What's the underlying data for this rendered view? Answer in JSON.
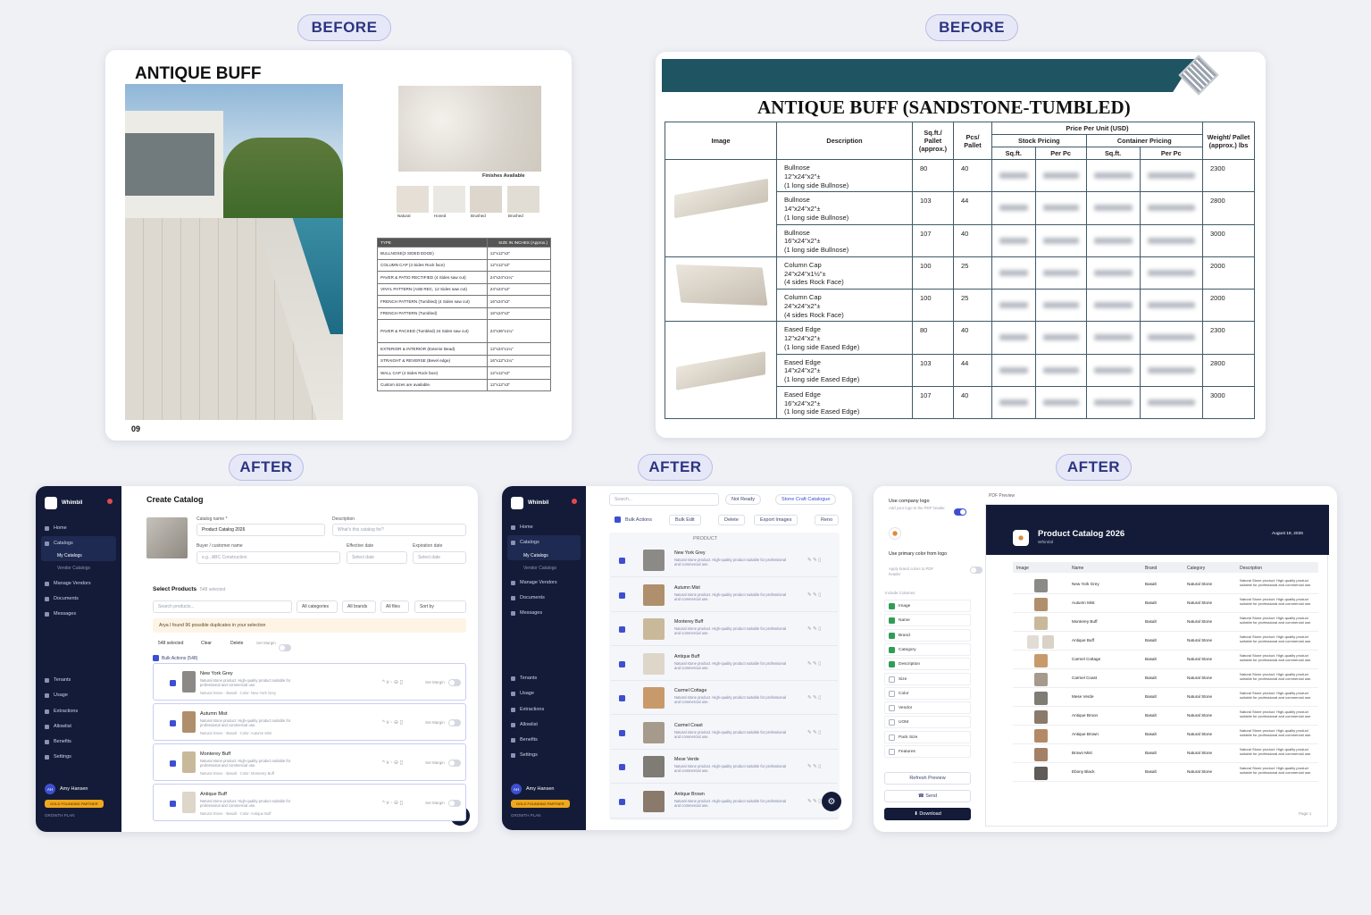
{
  "labels": {
    "before": "BEFORE",
    "after": "AFTER"
  },
  "before1": {
    "title": "ANTIQUE BUFF",
    "finishes_title": "Finishes Available",
    "finishes": [
      "Natural",
      "Honed",
      "Brushed",
      "Brushed"
    ],
    "table_header": [
      "TYPE",
      "SIZE IN INCHES (Approx.)"
    ],
    "rows": [
      [
        "BULLNOSE(3 SIDED EDGE)",
        "12\"x12\"x2\"",
        "12\"x12\"x2\""
      ],
      [
        "COLUMN CAP (4 Sides Rock face)",
        "12\"x12\"x2\""
      ],
      [
        "PAVER & PATIO RECTIFIED (4 Sides saw cut)",
        "24\"x24\"x1¼\""
      ],
      [
        "VINYL PATTERN (ASB REC, 12 Sides saw cut)",
        "24\"x24\"x2\""
      ],
      [
        "FRENCH PATTERN (Tumbled) (4 Sides saw cut)",
        "16\"x24\"x2\""
      ],
      [
        "FRENCH PATTERN (Tumbled)",
        "16\"x24\"x2\""
      ],
      [
        "PAVER & PACKED (Tumbled) 24 Sides saw cut)",
        "24\"x36\"x1¼\"",
        "12\"x12\"x1¼\""
      ],
      [
        "EXTERIOR & INTERIOR (Exterior Bead)",
        "12\"x24\"x1¼\""
      ],
      [
        "STRAIGHT & REVERSE (Bevel edge)",
        "16\"x12\"x1¼\""
      ],
      [
        "WALL CAP (4 Sides Rock face)",
        "12\"x12\"x2\""
      ],
      [
        "Custom sizes are available.",
        "12\"x12\"x3\""
      ]
    ],
    "page_number": "09"
  },
  "before2": {
    "title": "ANTIQUE BUFF (SANDSTONE-TUMBLED)",
    "headers": {
      "image": "Image",
      "description": "Description",
      "sqft_pallet": "Sq.ft./ Pallet (approx.)",
      "pcs_pallet": "Pcs/ Pallet",
      "price_per_unit": "Price Per Unit (USD)",
      "stock": "Stock Pricing",
      "container": "Container Pricing",
      "sqft": "Sq.ft.",
      "perpc": "Per Pc",
      "weight": "Weight/ Pallet (approx.) lbs"
    },
    "rows": [
      {
        "d1": "Bullnose",
        "d2": "12\"x24\"x2\"±",
        "d3": "(1 long side Bullnose)",
        "sqft": "80",
        "pcs": "40",
        "w": "2300"
      },
      {
        "d1": "Bullnose",
        "d2": "14\"x24\"x2\"±",
        "d3": "(1 long side Bullnose)",
        "sqft": "103",
        "pcs": "44",
        "w": "2800"
      },
      {
        "d1": "Bullnose",
        "d2": "16\"x24\"x2\"±",
        "d3": "(1 long side Bullnose)",
        "sqft": "107",
        "pcs": "40",
        "w": "3000"
      },
      {
        "d1": "Column Cap",
        "d2": "24\"x24\"x1½\"±",
        "d3": "(4 sides Rock Face)",
        "sqft": "100",
        "pcs": "25",
        "w": "2000"
      },
      {
        "d1": "Column Cap",
        "d2": "24\"x24\"x2\"±",
        "d3": "(4 sides Rock Face)",
        "sqft": "100",
        "pcs": "25",
        "w": "2000"
      },
      {
        "d1": "Eased Edge",
        "d2": "12\"x24\"x2\"±",
        "d3": "(1 long side Eased Edge)",
        "sqft": "80",
        "pcs": "40",
        "w": "2300"
      },
      {
        "d1": "Eased Edge",
        "d2": "14\"x24\"x2\"±",
        "d3": "(1 long side Eased Edge)",
        "sqft": "103",
        "pcs": "44",
        "w": "2800"
      },
      {
        "d1": "Eased Edge",
        "d2": "16\"x24\"x2\"±",
        "d3": "(1 long side Eased Edge)",
        "sqft": "107",
        "pcs": "40",
        "w": "3000"
      }
    ]
  },
  "app": {
    "brand": "Whimbil",
    "nav": [
      "Home",
      "Catalogs",
      "My Catalogs",
      "Vendor Catalogs",
      "Manage Vendors",
      "Documents",
      "Messages"
    ],
    "nav2": [
      "Tenants",
      "Usage",
      "Extractions",
      "Allowlist",
      "Benefits",
      "Settings"
    ],
    "user": "Amy Hansen",
    "initials": "AH",
    "badge": "GOLD FOUNDING PARTNER",
    "plan": "GROWTH PLAN"
  },
  "after1": {
    "title": "Create Catalog",
    "catalog_name_label": "Catalog name *",
    "catalog_name_value": "Product Catalog 2026",
    "description_label": "Description",
    "description_placeholder": "What's this catalog for?",
    "buyer_label": "Buyer / customer name",
    "buyer_placeholder": "e.g., ABC Construction",
    "eff_label": "Effective date",
    "exp_label": "Expiration date",
    "date_placeholder": "Select date",
    "select_products": "Select Products",
    "selected_count": "548 selected",
    "search_placeholder": "Search products...",
    "filters": [
      "All categories",
      "All brands",
      "All files",
      "Sort by"
    ],
    "notice": "Arya  I found 96 possible duplicates in your selection",
    "sel_bar": [
      "548 selected",
      "Clear",
      "Delete",
      "Set Margin"
    ],
    "bulk": "Bulk Actions (548)",
    "set_margin": "Set Margin",
    "items": [
      {
        "name": "New York Grey",
        "desc": "Natural stone product. High-quality product suitable for professional and commercial use.",
        "meta": "Natural Stone · Basalt · Color: New York Grey"
      },
      {
        "name": "Autumn Mist",
        "desc": "Natural stone product. High-quality product suitable for professional and commercial use.",
        "meta": "Natural Stone · Basalt · Color: Autumn Mist"
      },
      {
        "name": "Monterey Buff",
        "desc": "Natural stone product. High-quality product suitable for professional and commercial use.",
        "meta": "Natural Stone · Basalt · Color: Monterey Buff"
      },
      {
        "name": "Antique Buff",
        "desc": "Natural stone product. High-quality product suitable for professional and commercial use.",
        "meta": "Natural Stone · Basalt · Color: Antique Buff"
      }
    ]
  },
  "after2": {
    "search_placeholder": "Search...",
    "chip1": "Not Ready",
    "chip2": "Stone Craft Catalogue",
    "actions": [
      "Bulk Actions",
      "Bulk Edit",
      "Delete",
      "Export Images",
      "Reno"
    ],
    "col": "PRODUCT",
    "items": [
      {
        "name": "New York Grey"
      },
      {
        "name": "Autumn Mist"
      },
      {
        "name": "Monterey Buff"
      },
      {
        "name": "Antique Buff"
      },
      {
        "name": "Carmel Cottage"
      },
      {
        "name": "Carmel Coast"
      },
      {
        "name": "Mese Verde"
      },
      {
        "name": "Antique Brown"
      }
    ],
    "item_desc": "Natural stone product. High-quality product suitable for professional and commercial use."
  },
  "after3": {
    "use_logo": "Use company logo",
    "use_logo_sub": "Add your logo to the PDF header",
    "use_color": "Use primary color from logo",
    "use_color_sub": "Apply brand colors to PDF header",
    "include_columns": "Include Columns",
    "columns": [
      {
        "label": "Image",
        "on": true
      },
      {
        "label": "Name",
        "on": true
      },
      {
        "label": "Brand",
        "on": true
      },
      {
        "label": "Category",
        "on": true
      },
      {
        "label": "Description",
        "on": true
      },
      {
        "label": "Size",
        "on": false
      },
      {
        "label": "Color",
        "on": false
      },
      {
        "label": "Vendor",
        "on": false
      },
      {
        "label": "UOM",
        "on": false
      },
      {
        "label": "Pack Size",
        "on": false
      },
      {
        "label": "Features",
        "on": false
      }
    ],
    "refresh": "Refresh Preview",
    "send": "Send",
    "download": "Download",
    "preview_label": "PDF Preview",
    "pdf_title": "Product Catalog 2026",
    "pdf_sub": "Whimbil",
    "pdf_date": "August 19, 2026",
    "pdf_cols": [
      "Image",
      "Name",
      "Brand",
      "Category",
      "Description"
    ],
    "pdf_rows": [
      "New York Grey",
      "Autumn Mist",
      "Monterey Buff",
      "Antique Buff",
      "Carmel Cottage",
      "Carmel Coast",
      "Mese Verde",
      "Antique Broon",
      "Antique Brown",
      "Brown Mist",
      "Ebony Black"
    ],
    "pdf_brand": "Basalt",
    "pdf_cat": "Natural Stone",
    "pdf_desc": "Natural Stone product. High-quality product suitable for professional and commercial use.",
    "page": "Page 1"
  }
}
